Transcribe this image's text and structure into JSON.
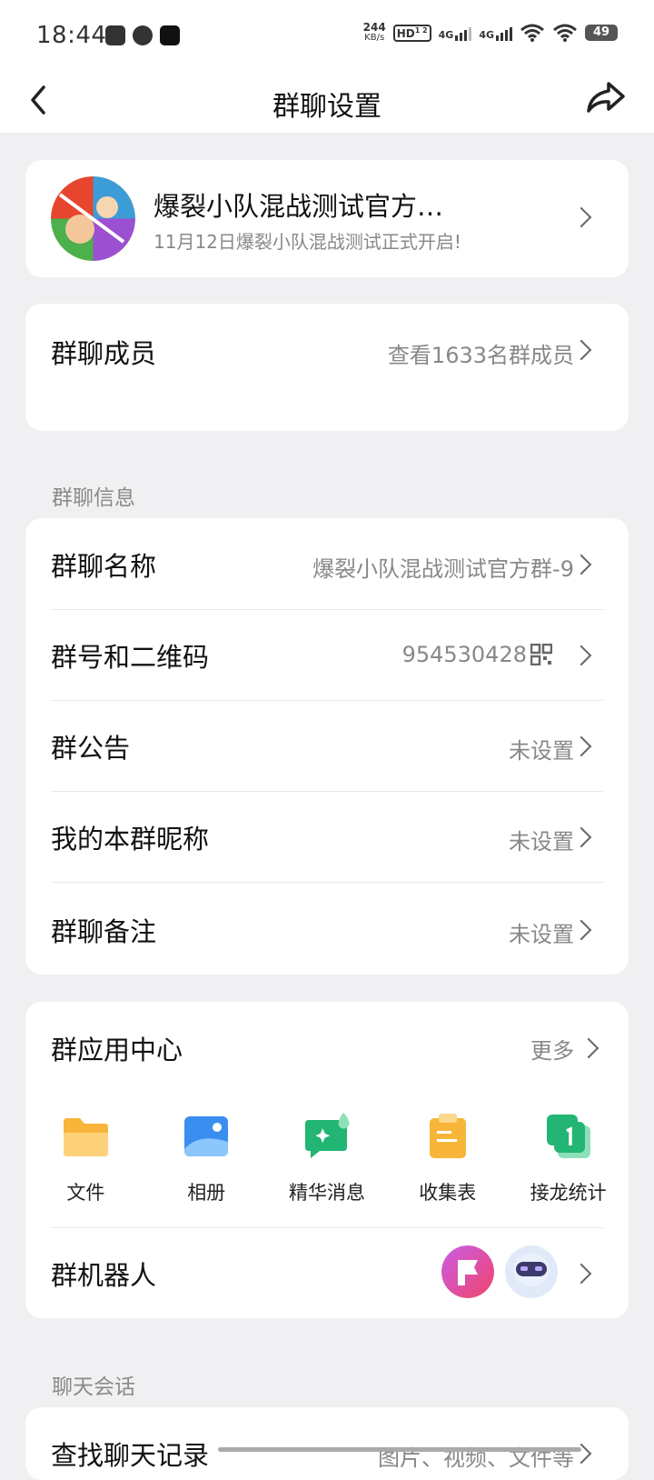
{
  "status_bar": {
    "time": "18:44",
    "speed_value": "244",
    "speed_unit": "KB/s",
    "hd": "HD",
    "hd_sub": "1 2",
    "net1": "4G",
    "net2": "4G",
    "battery": "49"
  },
  "nav": {
    "title": "群聊设置"
  },
  "group_card": {
    "name": "爆裂小队混战测试官方…",
    "subtitle": "11月12日爆裂小队混战测试正式开启!"
  },
  "members": {
    "label": "群聊成员",
    "value": "查看1633名群成员"
  },
  "info_section": {
    "title": "群聊信息",
    "rows": [
      {
        "label": "群聊名称",
        "value": "爆裂小队混战测试官方群-9"
      },
      {
        "label": "群号和二维码",
        "value": "954530428"
      },
      {
        "label": "群公告",
        "value": "未设置"
      },
      {
        "label": "我的本群昵称",
        "value": "未设置"
      },
      {
        "label": "群聊备注",
        "value": "未设置"
      }
    ]
  },
  "app_center": {
    "title": "群应用中心",
    "more": "更多",
    "apps": [
      {
        "label": "文件",
        "icon": "folder-icon",
        "color": "#f8b53c"
      },
      {
        "label": "相册",
        "icon": "album-icon",
        "color": "#3a8ef0"
      },
      {
        "label": "精华消息",
        "icon": "essence-message-icon",
        "color": "#22b573"
      },
      {
        "label": "收集表",
        "icon": "clipboard-icon",
        "color": "#f8b53c"
      },
      {
        "label": "接龙统计",
        "icon": "solitaire-stats-icon",
        "color": "#22b573"
      }
    ],
    "robots_label": "群机器人"
  },
  "chat_section": {
    "title": "聊天会话",
    "search_label": "查找聊天记录",
    "search_value": "图片、视频、文件等"
  }
}
